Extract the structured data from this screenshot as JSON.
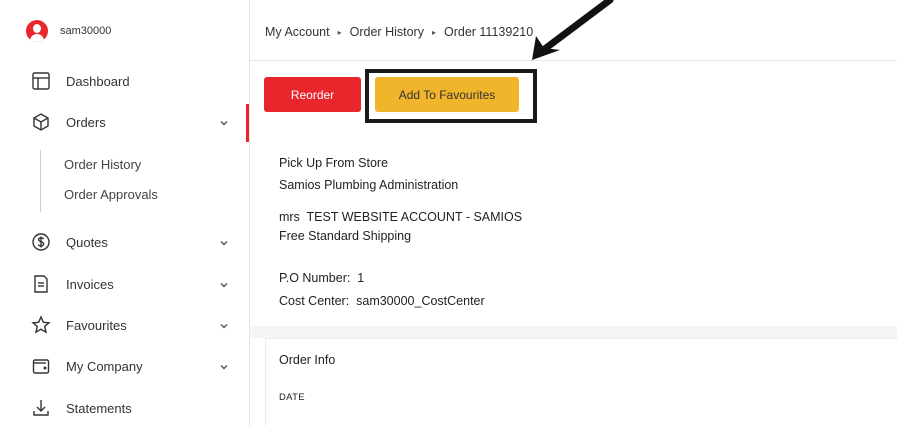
{
  "user": {
    "username": "sam30000"
  },
  "sidebar": {
    "items": [
      {
        "label": "Dashboard",
        "icon": "dashboard-icon"
      },
      {
        "label": "Orders",
        "icon": "box-icon"
      },
      {
        "label": "Quotes",
        "icon": "dollar-icon"
      },
      {
        "label": "Invoices",
        "icon": "invoice-icon"
      },
      {
        "label": "Favourites",
        "icon": "star-icon"
      },
      {
        "label": "My Company",
        "icon": "wallet-icon"
      },
      {
        "label": "Statements",
        "icon": "download-icon"
      }
    ],
    "sub_items": [
      {
        "label": "Order History"
      },
      {
        "label": "Order Approvals"
      }
    ]
  },
  "breadcrumb": {
    "items": [
      "My Account",
      "Order History",
      "Order 11139210"
    ]
  },
  "actions": {
    "reorder_label": "Reorder",
    "favourites_label": "Add To Favourites"
  },
  "order": {
    "delivery_method": "Pick Up From Store",
    "store_name": "Samios Plumbing Administration",
    "account_name": "mrs  TEST WEBSITE ACCOUNT - SAMIOS",
    "shipping": "Free Standard Shipping",
    "po_number": "P.O Number:  1",
    "cost_center": "Cost Center:  sam30000_CostCenter"
  },
  "order_info": {
    "title": "Order Info",
    "date_label": "DATE"
  },
  "colors": {
    "accent_red": "#e8262b",
    "accent_yellow": "#f0b52a"
  }
}
